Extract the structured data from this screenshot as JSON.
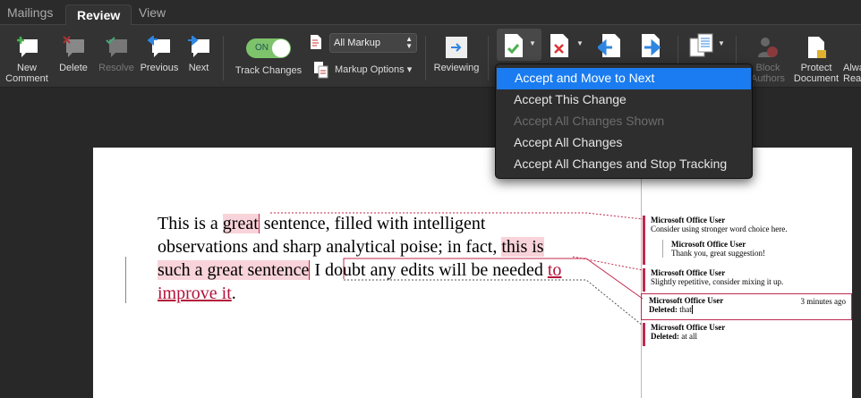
{
  "tabs": [
    "Mailings",
    "Review",
    "View"
  ],
  "ribbon": {
    "new_comment": "New\nComment",
    "delete": "Delete",
    "resolve": "Resolve",
    "previous": "Previous",
    "next": "Next",
    "toggle": "ON",
    "track_changes": "Track Changes",
    "markup_select": "All Markup",
    "markup_options": "Markup Options ▾",
    "reviewing": "Reviewing",
    "block_authors": "Block\nAuthors",
    "protect_document": "Protect\nDocument",
    "always": "Alwa\nRea"
  },
  "accept_menu": [
    "Accept and Move to Next",
    "Accept This Change",
    "Accept All Changes Shown",
    "Accept All Changes",
    "Accept All Changes and Stop Tracking"
  ],
  "document": {
    "t1": "This is a ",
    "t2": "great",
    "t3": " sentence, filled with intelligent observations and sharp analytical poise; in fact, ",
    "t4": "this is such a great sentence",
    "t5": " I doubt any edits will be needed ",
    "t6": "to improve it",
    "t7": "."
  },
  "comments": [
    {
      "author": "Microsoft Office User",
      "text": "Consider using stronger word choice here."
    },
    {
      "author": "Microsoft Office User",
      "text": "Thank you, great suggestion!"
    },
    {
      "author": "Microsoft Office User",
      "text": "Slightly repetitive, consider mixing it up."
    },
    {
      "author": "Microsoft Office User",
      "time": "3 minutes ago",
      "label": "Deleted:",
      "text": "that"
    },
    {
      "author": "Microsoft Office User",
      "label": "Deleted:",
      "text": "at all"
    }
  ],
  "colors": {
    "accent": "#1a7cf0",
    "markup": "#c0294e",
    "highlight": "#f8d3d9"
  }
}
